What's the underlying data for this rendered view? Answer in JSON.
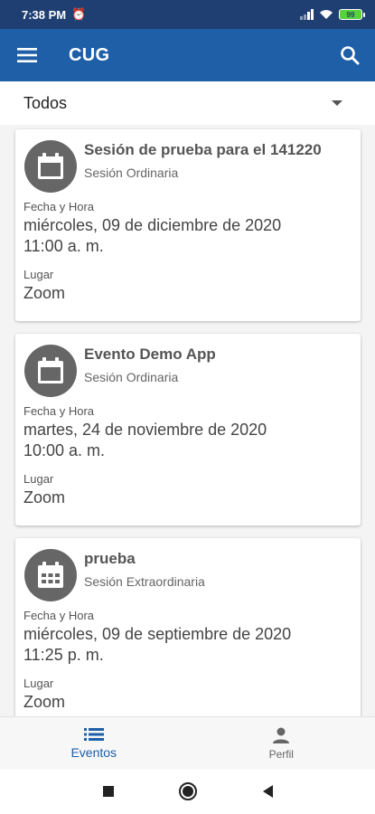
{
  "status_bar": {
    "time": "7:38 PM",
    "battery": "99"
  },
  "app_bar": {
    "title": "CUG"
  },
  "filter": {
    "selected": "Todos"
  },
  "events": [
    {
      "title": "Sesión de prueba para el 141220",
      "type": "Sesión Ordinaria",
      "date_label": "Fecha y Hora",
      "date": "miércoles, 09 de diciembre de 2020",
      "time": "11:00 a. m.",
      "place_label": "Lugar",
      "place": "Zoom",
      "icon": "calendar-icon"
    },
    {
      "title": "Evento Demo App",
      "type": "Sesión Ordinaria",
      "date_label": "Fecha y Hora",
      "date": "martes, 24 de noviembre de 2020",
      "time": "10:00 a. m.",
      "place_label": "Lugar",
      "place": "Zoom",
      "icon": "calendar-icon"
    },
    {
      "title": "prueba",
      "type": "Sesión Extraordinaria",
      "date_label": "Fecha y Hora",
      "date": "miércoles, 09 de septiembre de 2020",
      "time": "11:25 p. m.",
      "place_label": "Lugar",
      "place": "Zoom",
      "icon": "calendar-grid-icon"
    }
  ],
  "bottom_nav": {
    "items": [
      {
        "label": "Eventos",
        "icon": "list-icon",
        "active": true
      },
      {
        "label": "Perfil",
        "icon": "person-icon",
        "active": false
      }
    ]
  },
  "colors": {
    "primary": "#1f5fa8",
    "status_bar": "#1f3f73",
    "avatar": "#666666"
  }
}
